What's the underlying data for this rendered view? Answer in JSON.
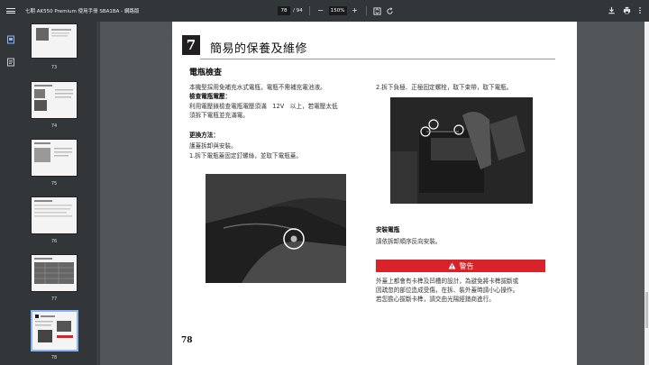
{
  "viewer": {
    "title": "七期 AK550 Premium 使用手冊 SBA1BA - 網路版",
    "page_current": "78",
    "page_total": "/ 94",
    "zoom": "150%",
    "zoom_minus": "−",
    "zoom_plus": "+"
  },
  "thumbnails": [
    {
      "label": "73"
    },
    {
      "label": "74"
    },
    {
      "label": "75"
    },
    {
      "label": "76"
    },
    {
      "label": "77"
    },
    {
      "label": "78",
      "active": true
    }
  ],
  "page": {
    "chapter_number": "7",
    "chapter_title": "簡易的保養及維修",
    "page_number": "78",
    "left": {
      "heading": "電瓶檢查",
      "line1": "本機型採用免補充水式電瓶，電瓶不需補充電池液。",
      "sub1": "檢查電瓶電壓：",
      "line2": "利用電壓錶檢查電瓶電壓須滿　12V　以上，若電壓太低",
      "line3": "須拆下電瓶並充滿電。",
      "sub2": "更換方法：",
      "line4": "護蓋拆卸與安裝。",
      "line5": "1.拆下電瓶蓋固定釘螺絲，並取下電瓶蓋。"
    },
    "right": {
      "step2": "2.拆下負極、正極固定螺栓，取下束帶，取下電瓶。",
      "install_heading": "安裝電瓶",
      "install_text": "請依拆卸順序反向安裝。",
      "warning_label": "警告",
      "warn1": "外蓋上都會有卡榫及凹槽的設計，為避免將卡榫拔斷或",
      "warn2": "因疏忽的部位造成受傷，在拆、裝外蓋時請小心操作。",
      "warn3": "若您擔心拔斷卡榫，請交由光陽經銷商進行。"
    }
  },
  "colors": {
    "toolbar": "#323639",
    "canvas": "#525659",
    "warning": "#d8232a",
    "active_thumb_border": "#8ab4f8"
  }
}
